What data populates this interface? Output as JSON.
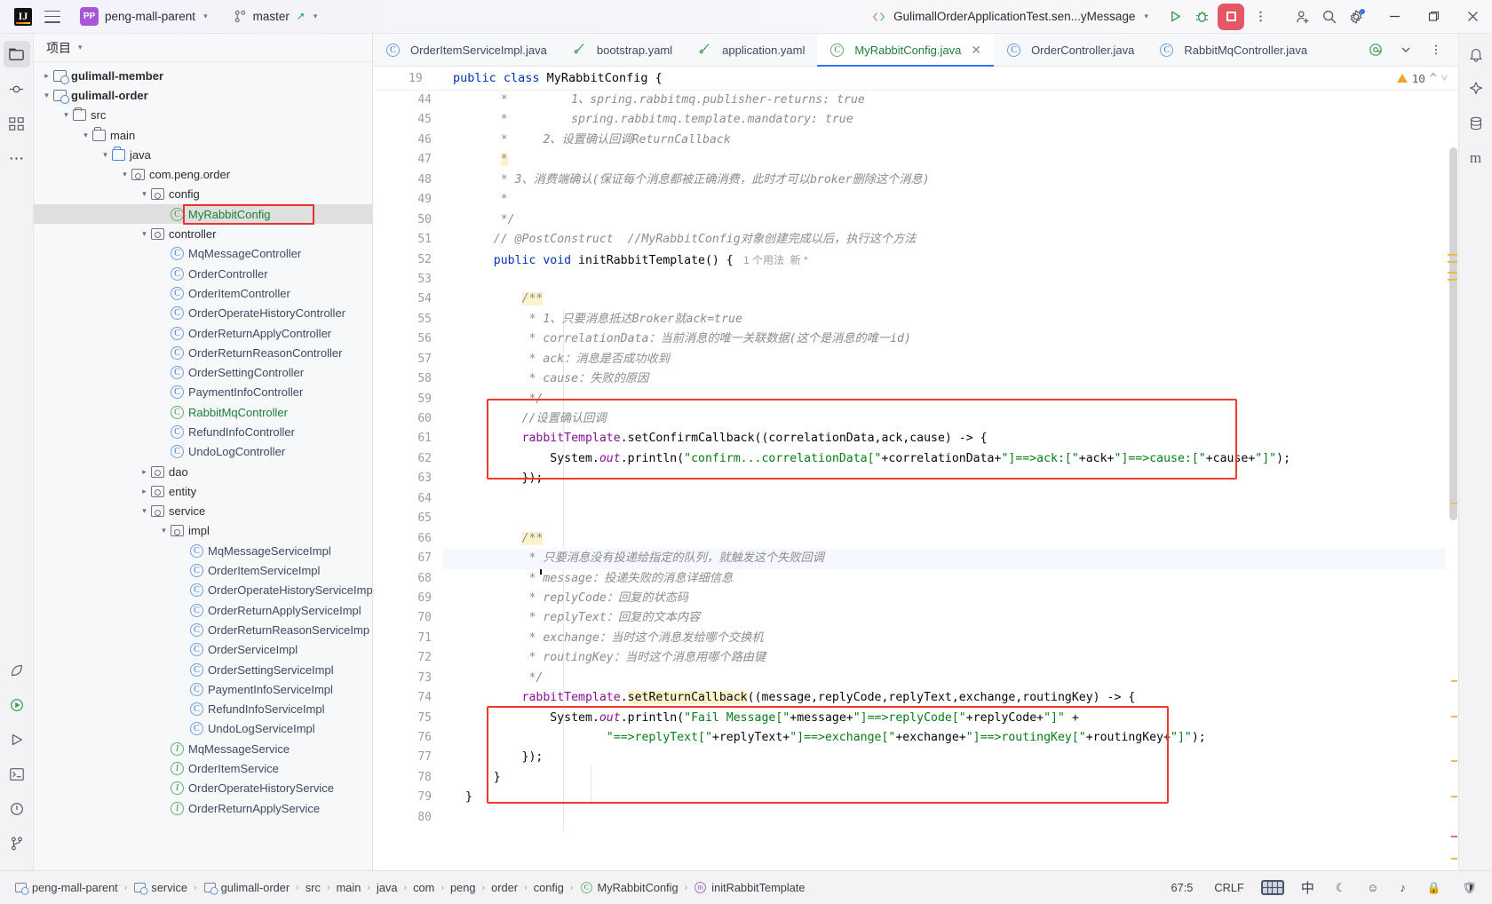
{
  "titlebar": {
    "logo": "IJ",
    "project": "peng-mall-parent",
    "branch": "master",
    "run_config": "GulimallOrderApplicationTest.sen...yMessage",
    "icons": {
      "burger": "hamburger-menu-icon",
      "vcs": "branch-icon",
      "run": "run-icon",
      "debug": "debug-icon",
      "stop": "stop-icon",
      "more": "more-vertical-icon",
      "share": "add-user-icon",
      "search": "search-icon",
      "settings": "gear-icon",
      "minimize": "minimize-icon",
      "maximize": "maximize-icon",
      "close": "close-icon"
    }
  },
  "left_rail": {
    "items": [
      {
        "name": "project-tool-icon",
        "glyph": "folder"
      },
      {
        "name": "commit-tool-icon",
        "glyph": "commit"
      },
      {
        "name": "structure-tool-icon",
        "glyph": "structure"
      },
      {
        "name": "more-tool-icon",
        "glyph": "dots"
      }
    ],
    "bottom_items": [
      {
        "name": "bean-tool-icon",
        "glyph": "bean"
      },
      {
        "name": "services-tool-icon",
        "glyph": "services"
      },
      {
        "name": "run-tool-icon",
        "glyph": "run"
      },
      {
        "name": "terminal-tool-icon",
        "glyph": "terminal"
      },
      {
        "name": "problems-tool-icon",
        "glyph": "problem"
      },
      {
        "name": "git-tool-icon",
        "glyph": "git"
      }
    ]
  },
  "right_rail": {
    "items": [
      {
        "name": "notifications-icon",
        "glyph": "bell"
      },
      {
        "name": "ai-assistant-icon",
        "glyph": "ai"
      },
      {
        "name": "database-icon",
        "glyph": "db"
      },
      {
        "name": "maven-icon",
        "glyph": "m"
      }
    ]
  },
  "project_panel": {
    "title": "项目",
    "tree": [
      {
        "indent": 2,
        "arrow": "right",
        "icon": "module",
        "label": "gulimall-member",
        "style": "bold"
      },
      {
        "indent": 2,
        "arrow": "down",
        "icon": "module",
        "label": "gulimall-order",
        "style": "bold"
      },
      {
        "indent": 3,
        "arrow": "down",
        "icon": "folder",
        "label": "src",
        "style": "dark"
      },
      {
        "indent": 4,
        "arrow": "down",
        "icon": "folder",
        "label": "main",
        "style": "dark"
      },
      {
        "indent": 5,
        "arrow": "down",
        "icon": "folder-blue",
        "label": "java",
        "style": "dark"
      },
      {
        "indent": 6,
        "arrow": "down",
        "icon": "package",
        "label": "com.peng.order",
        "style": "dark"
      },
      {
        "indent": 7,
        "arrow": "down",
        "icon": "package",
        "label": "config",
        "style": "dark"
      },
      {
        "indent": 8,
        "arrow": "none",
        "icon": "class-green",
        "label": "MyRabbitConfig",
        "style": "green",
        "selected": true,
        "boxed": true
      },
      {
        "indent": 7,
        "arrow": "down",
        "icon": "package",
        "label": "controller",
        "style": "dark"
      },
      {
        "indent": 8,
        "arrow": "none",
        "icon": "class",
        "label": "MqMessageController",
        "style": "blueish"
      },
      {
        "indent": 8,
        "arrow": "none",
        "icon": "class",
        "label": "OrderController",
        "style": "blueish"
      },
      {
        "indent": 8,
        "arrow": "none",
        "icon": "class",
        "label": "OrderItemController",
        "style": "blueish"
      },
      {
        "indent": 8,
        "arrow": "none",
        "icon": "class",
        "label": "OrderOperateHistoryController",
        "style": "blueish"
      },
      {
        "indent": 8,
        "arrow": "none",
        "icon": "class",
        "label": "OrderReturnApplyController",
        "style": "blueish"
      },
      {
        "indent": 8,
        "arrow": "none",
        "icon": "class",
        "label": "OrderReturnReasonController",
        "style": "blueish"
      },
      {
        "indent": 8,
        "arrow": "none",
        "icon": "class",
        "label": "OrderSettingController",
        "style": "blueish"
      },
      {
        "indent": 8,
        "arrow": "none",
        "icon": "class",
        "label": "PaymentInfoController",
        "style": "blueish"
      },
      {
        "indent": 8,
        "arrow": "none",
        "icon": "class-green",
        "label": "RabbitMqController",
        "style": "green"
      },
      {
        "indent": 8,
        "arrow": "none",
        "icon": "class",
        "label": "RefundInfoController",
        "style": "blueish"
      },
      {
        "indent": 8,
        "arrow": "none",
        "icon": "class",
        "label": "UndoLogController",
        "style": "blueish"
      },
      {
        "indent": 7,
        "arrow": "right",
        "icon": "package",
        "label": "dao",
        "style": "dark"
      },
      {
        "indent": 7,
        "arrow": "right",
        "icon": "package",
        "label": "entity",
        "style": "dark"
      },
      {
        "indent": 7,
        "arrow": "down",
        "icon": "package",
        "label": "service",
        "style": "dark"
      },
      {
        "indent": 8,
        "arrow": "down",
        "icon": "package",
        "label": "impl",
        "style": "dark"
      },
      {
        "indent": 9,
        "arrow": "none",
        "icon": "class",
        "label": "MqMessageServiceImpl",
        "style": "blueish"
      },
      {
        "indent": 9,
        "arrow": "none",
        "icon": "class",
        "label": "OrderItemServiceImpl",
        "style": "blueish"
      },
      {
        "indent": 9,
        "arrow": "none",
        "icon": "class",
        "label": "OrderOperateHistoryServiceImp",
        "style": "blueish"
      },
      {
        "indent": 9,
        "arrow": "none",
        "icon": "class",
        "label": "OrderReturnApplyServiceImpl",
        "style": "blueish"
      },
      {
        "indent": 9,
        "arrow": "none",
        "icon": "class",
        "label": "OrderReturnReasonServiceImp",
        "style": "blueish"
      },
      {
        "indent": 9,
        "arrow": "none",
        "icon": "class",
        "label": "OrderServiceImpl",
        "style": "blueish"
      },
      {
        "indent": 9,
        "arrow": "none",
        "icon": "class",
        "label": "OrderSettingServiceImpl",
        "style": "blueish"
      },
      {
        "indent": 9,
        "arrow": "none",
        "icon": "class",
        "label": "PaymentInfoServiceImpl",
        "style": "blueish"
      },
      {
        "indent": 9,
        "arrow": "none",
        "icon": "class",
        "label": "RefundInfoServiceImpl",
        "style": "blueish"
      },
      {
        "indent": 9,
        "arrow": "none",
        "icon": "class",
        "label": "UndoLogServiceImpl",
        "style": "blueish"
      },
      {
        "indent": 8,
        "arrow": "none",
        "icon": "interface",
        "label": "MqMessageService",
        "style": "blueish"
      },
      {
        "indent": 8,
        "arrow": "none",
        "icon": "interface",
        "label": "OrderItemService",
        "style": "blueish"
      },
      {
        "indent": 8,
        "arrow": "none",
        "icon": "interface",
        "label": "OrderOperateHistoryService",
        "style": "blueish"
      },
      {
        "indent": 8,
        "arrow": "none",
        "icon": "interface",
        "label": "OrderReturnApplyService",
        "style": "blueish"
      }
    ]
  },
  "editor": {
    "tabs": [
      {
        "label": "OrderItemServiceImpl.java",
        "icon": "class",
        "color": "blue",
        "active": false,
        "closable": false
      },
      {
        "label": "bootstrap.yaml",
        "icon": "yaml",
        "color": "blue",
        "active": false,
        "closable": false
      },
      {
        "label": "application.yaml",
        "icon": "yaml",
        "color": "blue",
        "active": false,
        "closable": false
      },
      {
        "label": "MyRabbitConfig.java",
        "icon": "class-green",
        "color": "green",
        "active": true,
        "closable": true
      },
      {
        "label": "OrderController.java",
        "icon": "class",
        "color": "blue",
        "active": false,
        "closable": false
      },
      {
        "label": "RabbitMqController.java",
        "icon": "class",
        "color": "blue",
        "active": false,
        "closable": false
      }
    ],
    "tabbar_right_icons": [
      "at-icon",
      "chevron-down-icon",
      "more-vertical-icon"
    ],
    "sticky_header": {
      "line_no": "19",
      "text": "public class MyRabbitConfig {"
    },
    "warnings": {
      "count": "10",
      "up": "⌃",
      "down": "⌄"
    },
    "lines": [
      {
        "no": "44",
        "partial": true,
        "html": "<span class=\"cmt\">     *         1、spring.rabbitmq.publisher-returns: true</span>"
      },
      {
        "no": "45",
        "html": "<span class=\"cmt\">     *         spring.rabbitmq.template.mandatory: true</span>"
      },
      {
        "no": "46",
        "html": "<span class=\"cmt\">     *     2、设置确认回调ReturnCallback</span>"
      },
      {
        "no": "47",
        "html": "<span class=\"cmt\">     </span><span class=\"cmt-hl\">*</span>"
      },
      {
        "no": "48",
        "html": "<span class=\"cmt\">     * 3、消费端确认(保证每个消息都被正确消费，此时才可以broker删除这个消息)</span>"
      },
      {
        "no": "49",
        "html": "<span class=\"cmt\">     *</span>"
      },
      {
        "no": "50",
        "html": "<span class=\"cmt\">     */</span>"
      },
      {
        "no": "51",
        "html": "<span class=\"cmt\">    // @PostConstruct  //MyRabbitConfig对象创建完成以后，执行这个方法</span>"
      },
      {
        "no": "52",
        "html": "<span class=\"plain\">    </span><span class=\"kw\">public void </span><span class=\"plain\">initRabbitTemplate() { </span><span class=\"hint\"> 1 个用法  新 *</span>"
      },
      {
        "no": "53",
        "html": ""
      },
      {
        "no": "54",
        "html": "<span class=\"plain\">        </span><span class=\"cmt-hl\">/**</span>"
      },
      {
        "no": "55",
        "html": "<span class=\"cmt\">         * 1、只要消息抵达Broker就ack=true</span>"
      },
      {
        "no": "56",
        "html": "<span class=\"cmt\">         * correlationData：当前消息的唯一关联数据(这个是消息的唯一id)</span>"
      },
      {
        "no": "57",
        "html": "<span class=\"cmt\">         * ack：消息是否成功收到</span>"
      },
      {
        "no": "58",
        "html": "<span class=\"cmt\">         * cause：失败的原因</span>"
      },
      {
        "no": "59",
        "html": "<span class=\"cmt\">         */</span>"
      },
      {
        "no": "60",
        "html": "<span class=\"cmt\">        //设置确认回调</span>"
      },
      {
        "no": "61",
        "html": "<span class=\"plain\">        </span><span class=\"purp\">rabbitTemplate</span><span class=\"plain\">.setConfirmCallback((correlationData,ack,cause) -&gt; {</span>"
      },
      {
        "no": "62",
        "html": "<span class=\"plain\">            System.</span><span class=\"fld\">out</span><span class=\"plain\">.println(</span><span class=\"str\">\"confirm...correlationData[\"</span><span class=\"plain\">+correlationData+</span><span class=\"str\">\"]==&gt;ack:[\"</span><span class=\"plain\">+ack+</span><span class=\"str\">\"]==&gt;cause:[\"</span><span class=\"plain\">+cause+</span><span class=\"str\">\"]\"</span><span class=\"plain\">);</span>"
      },
      {
        "no": "63",
        "html": "<span class=\"plain\">        });</span>"
      },
      {
        "no": "64",
        "html": ""
      },
      {
        "no": "65",
        "html": ""
      },
      {
        "no": "66",
        "html": "<span class=\"plain\">        </span><span class=\"cmt-hl\">/**</span>"
      },
      {
        "no": "67",
        "hl": true,
        "html": "<span class=\"cmt\">         * 只要消息没有投递给指定的队列，就触发这个失败回调</span>"
      },
      {
        "no": "68",
        "html": "<span class=\"cmt\">         * message：投递失败的消息详细信息</span>"
      },
      {
        "no": "69",
        "html": "<span class=\"cmt\">         * replyCode：回复的状态码</span>"
      },
      {
        "no": "70",
        "html": "<span class=\"cmt\">         * replyText：回复的文本内容</span>"
      },
      {
        "no": "71",
        "html": "<span class=\"cmt\">         * exchange：当时这个消息发给哪个交换机</span>"
      },
      {
        "no": "72",
        "html": "<span class=\"cmt\">         * routingKey：当时这个消息用哪个路由键</span>"
      },
      {
        "no": "73",
        "html": "<span class=\"cmt\">         */</span>"
      },
      {
        "no": "74",
        "html": "<span class=\"plain\">        </span><span class=\"purp\">rabbitTemplate</span><span class=\"plain\">.</span><span class=\"meth-hl\">setReturnCallback</span><span class=\"plain\">((message,replyCode,replyText,exchange,routingKey) -&gt; {</span>"
      },
      {
        "no": "75",
        "html": "<span class=\"plain\">            System.</span><span class=\"fld\">out</span><span class=\"plain\">.println(</span><span class=\"str\">\"Fail Message[\"</span><span class=\"plain\">+message+</span><span class=\"str\">\"]==&gt;replyCode[\"</span><span class=\"plain\">+replyCode+</span><span class=\"str\">\"]\"</span><span class=\"plain\"> +</span>"
      },
      {
        "no": "76",
        "html": "<span class=\"plain\">                    </span><span class=\"str\">\"==&gt;replyText[\"</span><span class=\"plain\">+replyText+</span><span class=\"str\">\"]==&gt;exchange[\"</span><span class=\"plain\">+exchange+</span><span class=\"str\">\"]==&gt;routingKey[\"</span><span class=\"plain\">+routingKey+</span><span class=\"str\">\"]\"</span><span class=\"plain\">);</span>"
      },
      {
        "no": "77",
        "html": "<span class=\"plain\">        });</span>"
      },
      {
        "no": "78",
        "html": "<span class=\"plain\">    }</span>"
      },
      {
        "no": "79",
        "html": "<span class=\"plain\">}</span>"
      },
      {
        "no": "80",
        "html": ""
      }
    ]
  },
  "statusbar": {
    "breadcrumbs": [
      {
        "label": "peng-mall-parent",
        "icon": "module"
      },
      {
        "label": "service",
        "icon": "module"
      },
      {
        "label": "gulimall-order",
        "icon": "module"
      },
      {
        "label": "src",
        "icon": "none"
      },
      {
        "label": "main",
        "icon": "none"
      },
      {
        "label": "java",
        "icon": "none"
      },
      {
        "label": "com",
        "icon": "none"
      },
      {
        "label": "peng",
        "icon": "none"
      },
      {
        "label": "order",
        "icon": "none"
      },
      {
        "label": "config",
        "icon": "none"
      },
      {
        "label": "MyRabbitConfig",
        "icon": "class-green"
      },
      {
        "label": "initRabbitTemplate",
        "icon": "method"
      }
    ],
    "caret": "67:5",
    "line_sep": "CRLF",
    "ime_lang": "中",
    "right_icons": [
      "keyboard-icon",
      "moon-icon",
      "emoji-icon",
      "sound-icon",
      "lock-icon",
      "shield-icon"
    ]
  }
}
